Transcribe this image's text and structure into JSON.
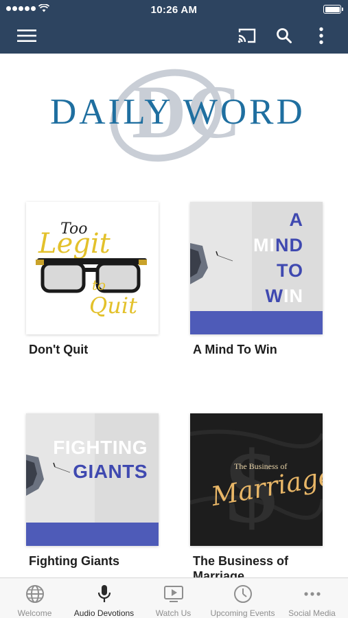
{
  "status_bar": {
    "time": "10:26 AM"
  },
  "header": {
    "menu_icon": "hamburger-menu-icon",
    "actions": [
      "cast-icon",
      "search-icon",
      "more-vertical-icon"
    ],
    "background_color": "#2d4460"
  },
  "logo": {
    "text": "DAILY WORD",
    "monogram": "DC",
    "text_color": "#1f6fa0"
  },
  "series": [
    {
      "title": "Don't Quit",
      "art": {
        "line1": "Too",
        "line2": "Legit",
        "line3": "to",
        "line4": "Quit"
      }
    },
    {
      "title": "A Mind To Win",
      "art": {
        "l1": "A",
        "l2a": "MI",
        "l2b": "ND",
        "l3": "TO",
        "l4a": "W",
        "l4b": "IN"
      }
    },
    {
      "title": "Fighting Giants",
      "art": {
        "l1": "FIGHTING",
        "l2": "GIANTS"
      }
    },
    {
      "title": "The Business of Marriage",
      "art": {
        "small": "The Business of",
        "big": "Marriage"
      }
    }
  ],
  "tabs": [
    {
      "label": "Welcome",
      "icon": "globe-icon",
      "active": false
    },
    {
      "label": "Audio Devotions",
      "icon": "microphone-icon",
      "active": true
    },
    {
      "label": "Watch Us",
      "icon": "video-play-icon",
      "active": false
    },
    {
      "label": "Upcoming Events",
      "icon": "clock-icon",
      "active": false
    },
    {
      "label": "Social Media",
      "icon": "more-horizontal-icon",
      "active": false
    }
  ],
  "colors": {
    "accent_blue": "#4e5bb8",
    "tab_active": "#2b2b2b",
    "tab_inactive": "#8e8e8e"
  }
}
